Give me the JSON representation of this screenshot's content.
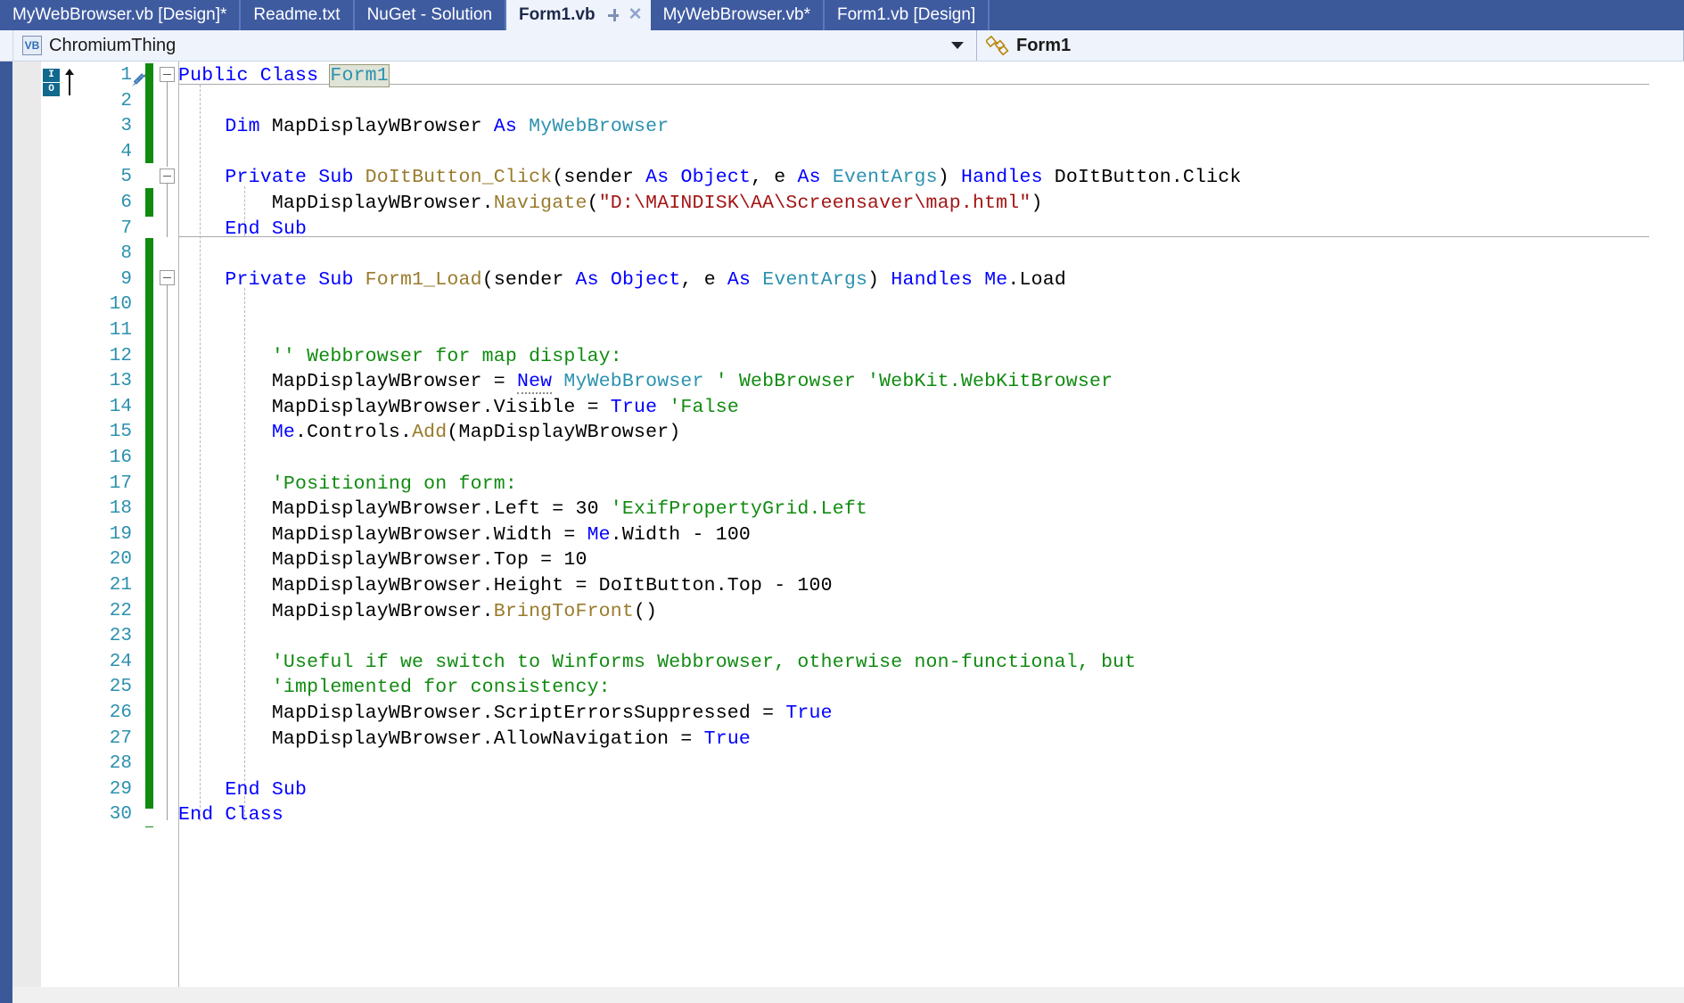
{
  "window": {
    "accent_color": "#3b5998",
    "active_tab_bg": "#eff3fb"
  },
  "tabs": [
    {
      "label": "MyWebBrowser.vb [Design]*",
      "active": false
    },
    {
      "label": "Readme.txt",
      "active": false
    },
    {
      "label": "NuGet - Solution",
      "active": false
    },
    {
      "label": "Form1.vb",
      "active": true
    },
    {
      "label": "MyWebBrowser.vb*",
      "active": false
    },
    {
      "label": "Form1.vb [Design]",
      "active": false
    }
  ],
  "tab_controls": {
    "pin_icon": "pin-icon",
    "close_icon": "close-icon",
    "close_glyph": "✕"
  },
  "navbar": {
    "project_icon": "VB",
    "project_dropdown_value": "ChromiumThing",
    "member_icon": "events-icon",
    "member_dropdown_value": "Form1",
    "caret_glyph": "▼"
  },
  "editor": {
    "first_visible_line": 1,
    "line_number_color": "#2b91af",
    "change_bar_color": "#108b10",
    "lines": [
      {
        "n": 1,
        "text": "Public Class Form1"
      },
      {
        "n": 2,
        "text": ""
      },
      {
        "n": 3,
        "text": "    Dim MapDisplayWBrowser As MyWebBrowser"
      },
      {
        "n": 4,
        "text": ""
      },
      {
        "n": 5,
        "text": "    Private Sub DoItButton_Click(sender As Object, e As EventArgs) Handles DoItButton.Click"
      },
      {
        "n": 6,
        "text": "        MapDisplayWBrowser.Navigate(\"D:\\MAINDISK\\AA\\Screensaver\\map.html\")"
      },
      {
        "n": 7,
        "text": "    End Sub"
      },
      {
        "n": 8,
        "text": ""
      },
      {
        "n": 9,
        "text": "    Private Sub Form1_Load(sender As Object, e As EventArgs) Handles Me.Load"
      },
      {
        "n": 10,
        "text": ""
      },
      {
        "n": 11,
        "text": ""
      },
      {
        "n": 12,
        "text": "        '' Webbrowser for map display:"
      },
      {
        "n": 13,
        "text": "        MapDisplayWBrowser = New MyWebBrowser ' WebBrowser 'WebKit.WebKitBrowser"
      },
      {
        "n": 14,
        "text": "        MapDisplayWBrowser.Visible = True 'False"
      },
      {
        "n": 15,
        "text": "        Me.Controls.Add(MapDisplayWBrowser)"
      },
      {
        "n": 16,
        "text": ""
      },
      {
        "n": 17,
        "text": "        'Positioning on form:"
      },
      {
        "n": 18,
        "text": "        MapDisplayWBrowser.Left = 30 'ExifPropertyGrid.Left"
      },
      {
        "n": 19,
        "text": "        MapDisplayWBrowser.Width = Me.Width - 100"
      },
      {
        "n": 20,
        "text": "        MapDisplayWBrowser.Top = 10"
      },
      {
        "n": 21,
        "text": "        MapDisplayWBrowser.Height = DoItButton.Top - 100"
      },
      {
        "n": 22,
        "text": "        MapDisplayWBrowser.BringToFront()"
      },
      {
        "n": 23,
        "text": ""
      },
      {
        "n": 24,
        "text": "        'Useful if we switch to Winforms Webbrowser, otherwise non-functional, but"
      },
      {
        "n": 25,
        "text": "        'implemented for consistency:"
      },
      {
        "n": 26,
        "text": "        MapDisplayWBrowser.ScriptErrorsSuppressed = True"
      },
      {
        "n": 27,
        "text": "        MapDisplayWBrowser.AllowNavigation = True"
      },
      {
        "n": 28,
        "text": ""
      },
      {
        "n": 29,
        "text": "    End Sub"
      },
      {
        "n": 30,
        "text": "End Class"
      }
    ],
    "line_numbers": [
      "1",
      "2",
      "3",
      "4",
      "5",
      "6",
      "7",
      "8",
      "9",
      "10",
      "11",
      "12",
      "13",
      "14",
      "15",
      "16",
      "17",
      "18",
      "19",
      "20",
      "21",
      "22",
      "23",
      "24",
      "25",
      "26",
      "27",
      "28",
      "29",
      "30"
    ],
    "tokens": {
      "l1": [
        {
          "t": "Public",
          "c": "kw"
        },
        {
          "t": " ",
          "c": "plain"
        },
        {
          "t": "Class",
          "c": "kw"
        },
        {
          "t": " ",
          "c": "plain"
        },
        {
          "t": "Form1",
          "c": "type hl-ref"
        }
      ],
      "l3": [
        {
          "t": "    ",
          "c": "plain"
        },
        {
          "t": "Dim",
          "c": "kw"
        },
        {
          "t": " MapDisplayWBrowser ",
          "c": "plain"
        },
        {
          "t": "As",
          "c": "kw"
        },
        {
          "t": " ",
          "c": "plain"
        },
        {
          "t": "MyWebBrowser",
          "c": "type"
        }
      ],
      "l5": [
        {
          "t": "    ",
          "c": "plain"
        },
        {
          "t": "Private",
          "c": "kw"
        },
        {
          "t": " ",
          "c": "plain"
        },
        {
          "t": "Sub",
          "c": "kw"
        },
        {
          "t": " ",
          "c": "plain"
        },
        {
          "t": "DoItButton_Click",
          "c": "meth"
        },
        {
          "t": "(",
          "c": "op"
        },
        {
          "t": "sender ",
          "c": "plain"
        },
        {
          "t": "As",
          "c": "kw"
        },
        {
          "t": " ",
          "c": "plain"
        },
        {
          "t": "Object",
          "c": "kw"
        },
        {
          "t": ", e ",
          "c": "plain"
        },
        {
          "t": "As",
          "c": "kw"
        },
        {
          "t": " ",
          "c": "plain"
        },
        {
          "t": "EventArgs",
          "c": "type"
        },
        {
          "t": ")",
          "c": "op"
        },
        {
          "t": " ",
          "c": "plain"
        },
        {
          "t": "Handles",
          "c": "kw"
        },
        {
          "t": " DoItButton.Click",
          "c": "plain"
        }
      ],
      "l6": [
        {
          "t": "        MapDisplayWBrowser.",
          "c": "plain"
        },
        {
          "t": "Navigate",
          "c": "meth"
        },
        {
          "t": "(",
          "c": "op"
        },
        {
          "t": "\"D:\\MAINDISK\\AA\\Screensaver\\map.html\"",
          "c": "str"
        },
        {
          "t": ")",
          "c": "op"
        }
      ],
      "l7": [
        {
          "t": "    ",
          "c": "plain"
        },
        {
          "t": "End",
          "c": "kw"
        },
        {
          "t": " ",
          "c": "plain"
        },
        {
          "t": "Sub",
          "c": "kw"
        }
      ],
      "l9": [
        {
          "t": "    ",
          "c": "plain"
        },
        {
          "t": "Private",
          "c": "kw"
        },
        {
          "t": " ",
          "c": "plain"
        },
        {
          "t": "Sub",
          "c": "kw"
        },
        {
          "t": " ",
          "c": "plain"
        },
        {
          "t": "Form1_Load",
          "c": "meth"
        },
        {
          "t": "(",
          "c": "op"
        },
        {
          "t": "sender ",
          "c": "plain"
        },
        {
          "t": "As",
          "c": "kw"
        },
        {
          "t": " ",
          "c": "plain"
        },
        {
          "t": "Object",
          "c": "kw"
        },
        {
          "t": ", e ",
          "c": "plain"
        },
        {
          "t": "As",
          "c": "kw"
        },
        {
          "t": " ",
          "c": "plain"
        },
        {
          "t": "EventArgs",
          "c": "type"
        },
        {
          "t": ")",
          "c": "op"
        },
        {
          "t": " ",
          "c": "plain"
        },
        {
          "t": "Handles",
          "c": "kw"
        },
        {
          "t": " ",
          "c": "plain"
        },
        {
          "t": "Me",
          "c": "kw"
        },
        {
          "t": ".Load",
          "c": "plain"
        }
      ],
      "l12": [
        {
          "t": "        ",
          "c": "plain"
        },
        {
          "t": "'' Webbrowser for map display:",
          "c": "cmt"
        }
      ],
      "l13": [
        {
          "t": "        MapDisplayWBrowser = ",
          "c": "plain"
        },
        {
          "t": "New",
          "c": "kw squiggle-dots"
        },
        {
          "t": " ",
          "c": "plain"
        },
        {
          "t": "MyWebBrowser",
          "c": "type"
        },
        {
          "t": " ",
          "c": "plain"
        },
        {
          "t": "' WebBrowser 'WebKit.WebKitBrowser",
          "c": "cmt"
        }
      ],
      "l14": [
        {
          "t": "        MapDisplayWBrowser.Visible = ",
          "c": "plain"
        },
        {
          "t": "True",
          "c": "kw"
        },
        {
          "t": " ",
          "c": "plain"
        },
        {
          "t": "'False",
          "c": "cmt"
        }
      ],
      "l15": [
        {
          "t": "        ",
          "c": "plain"
        },
        {
          "t": "Me",
          "c": "kw"
        },
        {
          "t": ".Controls.",
          "c": "plain"
        },
        {
          "t": "Add",
          "c": "meth"
        },
        {
          "t": "(MapDisplayWBrowser)",
          "c": "plain"
        }
      ],
      "l17": [
        {
          "t": "        ",
          "c": "plain"
        },
        {
          "t": "'Positioning on form:",
          "c": "cmt"
        }
      ],
      "l18": [
        {
          "t": "        MapDisplayWBrowser.Left = 30 ",
          "c": "plain"
        },
        {
          "t": "'ExifPropertyGrid.Left",
          "c": "cmt"
        }
      ],
      "l19": [
        {
          "t": "        MapDisplayWBrowser.Width = ",
          "c": "plain"
        },
        {
          "t": "Me",
          "c": "kw"
        },
        {
          "t": ".Width - 100",
          "c": "plain"
        }
      ],
      "l20": [
        {
          "t": "        MapDisplayWBrowser.Top = 10",
          "c": "plain"
        }
      ],
      "l21": [
        {
          "t": "        MapDisplayWBrowser.Height = DoItButton.Top - 100",
          "c": "plain"
        }
      ],
      "l22": [
        {
          "t": "        MapDisplayWBrowser.",
          "c": "plain"
        },
        {
          "t": "BringToFront",
          "c": "meth"
        },
        {
          "t": "()",
          "c": "plain"
        }
      ],
      "l24": [
        {
          "t": "        ",
          "c": "plain"
        },
        {
          "t": "'Useful if we switch to Winforms Webbrowser, otherwise non-functional, but",
          "c": "cmt"
        }
      ],
      "l25": [
        {
          "t": "        ",
          "c": "plain"
        },
        {
          "t": "'implemented for consistency:",
          "c": "cmt"
        }
      ],
      "l26": [
        {
          "t": "        MapDisplayWBrowser.ScriptErrorsSuppressed = ",
          "c": "plain"
        },
        {
          "t": "True",
          "c": "kw"
        }
      ],
      "l27": [
        {
          "t": "        MapDisplayWBrowser.AllowNavigation = ",
          "c": "plain"
        },
        {
          "t": "True",
          "c": "kw"
        }
      ],
      "l29": [
        {
          "t": "    ",
          "c": "plain"
        },
        {
          "t": "End",
          "c": "kw"
        },
        {
          "t": " ",
          "c": "plain"
        },
        {
          "t": "Sub",
          "c": "kw"
        }
      ],
      "l30": [
        {
          "t": "End",
          "c": "kw"
        },
        {
          "t": " ",
          "c": "plain"
        },
        {
          "t": "Class",
          "c": "kw"
        }
      ]
    },
    "quick_action_icon": "screwdriver-icon",
    "collapse_glyph": "−",
    "outlining_lines": [
      1,
      5,
      9
    ]
  }
}
